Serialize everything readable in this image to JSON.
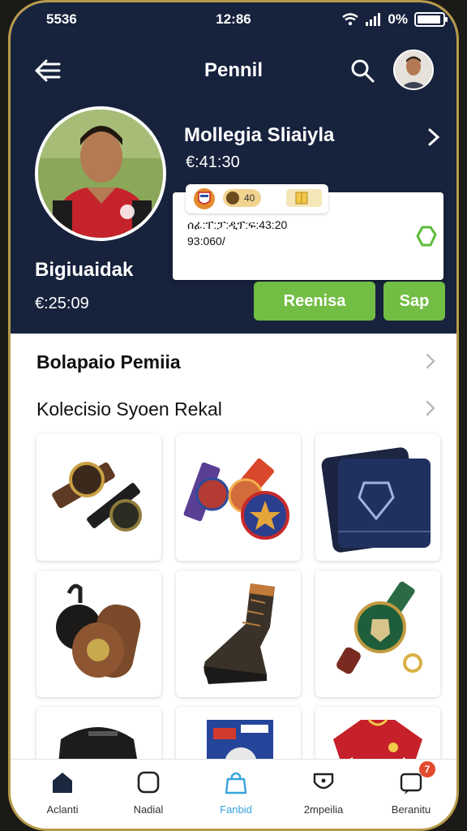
{
  "status_bar": {
    "left": "5536",
    "time": "12:86",
    "battery": "0%"
  },
  "header": {
    "title": "Pennil"
  },
  "profile": {
    "name": "Bigiuaidak",
    "amount": "€:25:09"
  },
  "feature": {
    "name": "Mollegia Sliaiyla",
    "amount": "€:41:30"
  },
  "stats": {
    "coin_label": "40",
    "line1": "ሰፊ:ፐ:ፓ:ዲፕ:ፍ:43:20",
    "line2": "93:060/"
  },
  "buttons": {
    "primary": "Reenisa",
    "secondary": "Sap"
  },
  "sections": [
    {
      "label": "Bolapaio Pemiia"
    },
    {
      "label": "Kolecisio Syoen Rekal"
    }
  ],
  "products": [
    {
      "name": "brown-belt-medal"
    },
    {
      "name": "purple-ribbon-medals"
    },
    {
      "name": "navy-wallet"
    },
    {
      "name": "leather-keychain"
    },
    {
      "name": "leather-boot"
    },
    {
      "name": "green-medal-keyring"
    },
    {
      "name": "black-bag"
    },
    {
      "name": "card-pack"
    },
    {
      "name": "red-jersey"
    }
  ],
  "bottom_nav": [
    {
      "label": "Aclanti",
      "icon": "home-icon"
    },
    {
      "label": "Nadial",
      "icon": "square-icon"
    },
    {
      "label": "Fanbid",
      "icon": "bag-icon"
    },
    {
      "label": "2mpeilia",
      "icon": "shield-icon"
    },
    {
      "label": "Beranitu",
      "icon": "chat-icon",
      "badge": "7"
    }
  ],
  "colors": {
    "header_bg": "#17223d",
    "accent_green": "#72bd43",
    "active_tab": "#36a3dd",
    "badge_red": "#e24a2d"
  }
}
